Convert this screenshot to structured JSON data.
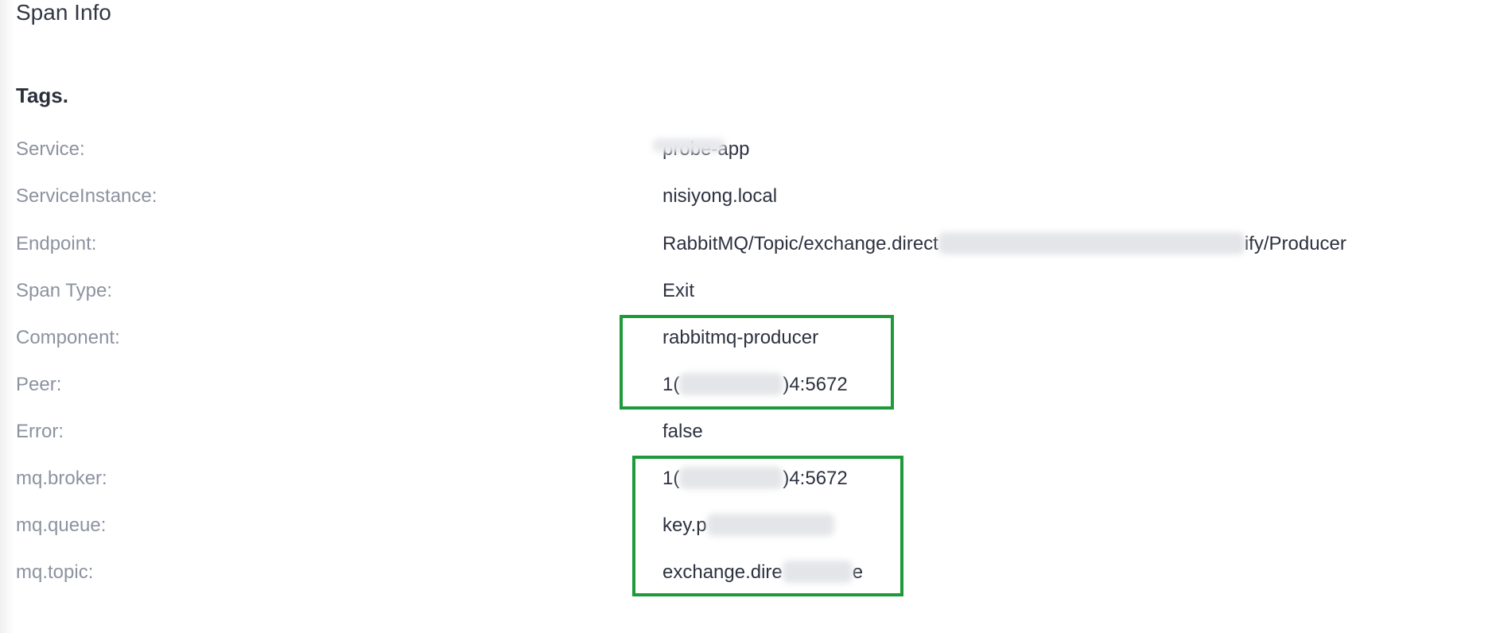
{
  "section_title": "Span Info",
  "tags_heading": "Tags.",
  "rows": [
    {
      "label": "Service:",
      "value_before": "probe-app",
      "value_after": ""
    },
    {
      "label": "ServiceInstance:",
      "value_before": "nisiyong.local",
      "value_after": ""
    },
    {
      "label": "Endpoint:",
      "value_before": "RabbitMQ/Topic/exchange.direct",
      "value_after": "ify/Producer"
    },
    {
      "label": "Span Type:",
      "value_before": "Exit",
      "value_after": ""
    },
    {
      "label": "Component:",
      "value_before": "rabbitmq-producer",
      "value_after": ""
    },
    {
      "label": "Peer:",
      "value_before": "1(",
      "value_after": ")4:5672"
    },
    {
      "label": "Error:",
      "value_before": "false",
      "value_after": ""
    },
    {
      "label": "mq.broker:",
      "value_before": "1(",
      "value_after": ")4:5672"
    },
    {
      "label": "mq.queue:",
      "value_before": "key.p",
      "value_after": ""
    },
    {
      "label": "mq.topic:",
      "value_before": "exchange.dire",
      "value_after": "e"
    }
  ],
  "colors": {
    "label": "#8c929f",
    "value": "#2d3140",
    "highlight": "#1e9a3a"
  }
}
